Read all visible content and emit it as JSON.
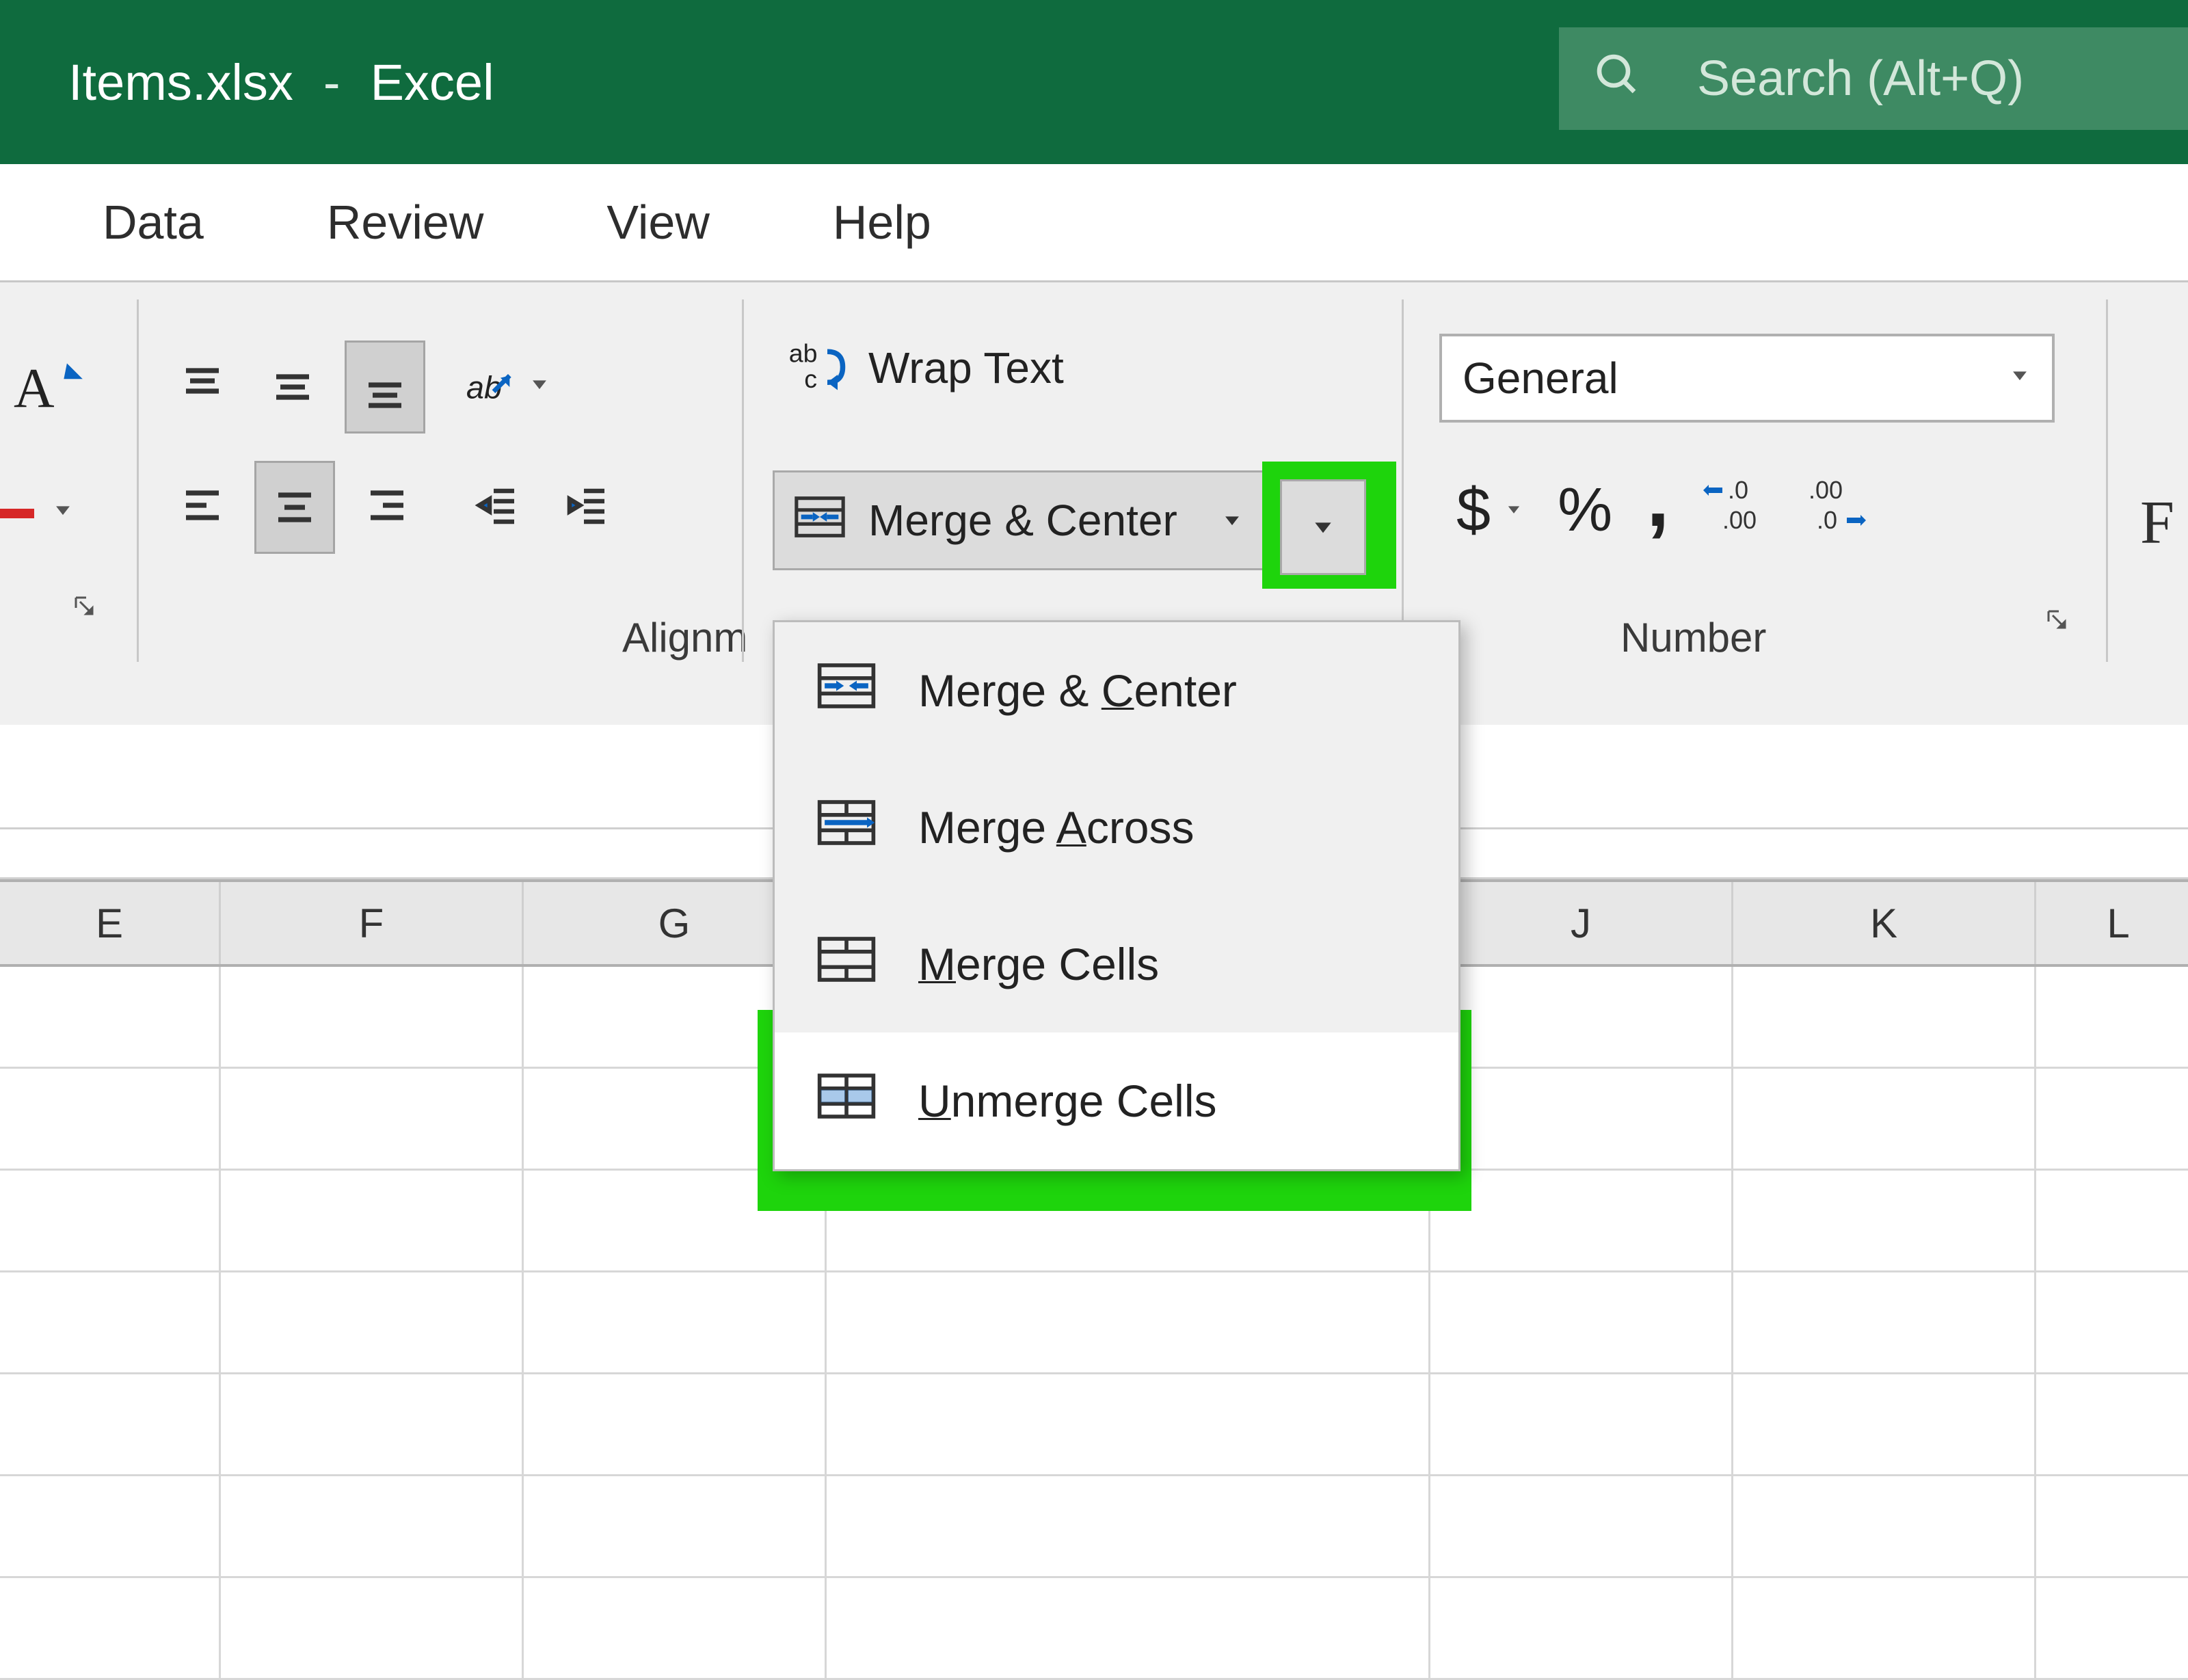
{
  "title": {
    "filename": "Items.xlsx",
    "separator": "-",
    "appname": "Excel"
  },
  "search": {
    "placeholder": "Search (Alt+Q)"
  },
  "tabs": [
    "Data",
    "Review",
    "View",
    "Help"
  ],
  "ribbon": {
    "wrap_text_label": "Wrap Text",
    "merge_button_label": "Merge & Center",
    "alignment_group_label": "Alignm",
    "number_group_label": "Number",
    "number_format_value": "General",
    "letter_fragment": "F"
  },
  "merge_dropdown": {
    "items": [
      {
        "label_pre": "Merge & ",
        "mnemonic": "C",
        "label_post": "enter",
        "icon": "merge-center"
      },
      {
        "label_pre": "Merge ",
        "mnemonic": "A",
        "label_post": "cross",
        "icon": "merge-across"
      },
      {
        "label_pre": "",
        "mnemonic": "M",
        "label_post": "erge Cells",
        "icon": "merge-cells"
      },
      {
        "label_pre": "",
        "mnemonic": "U",
        "label_post": "nmerge Cells",
        "icon": "unmerge-cells"
      }
    ]
  },
  "columns": [
    "E",
    "F",
    "G",
    "",
    "J",
    "K",
    "L"
  ]
}
